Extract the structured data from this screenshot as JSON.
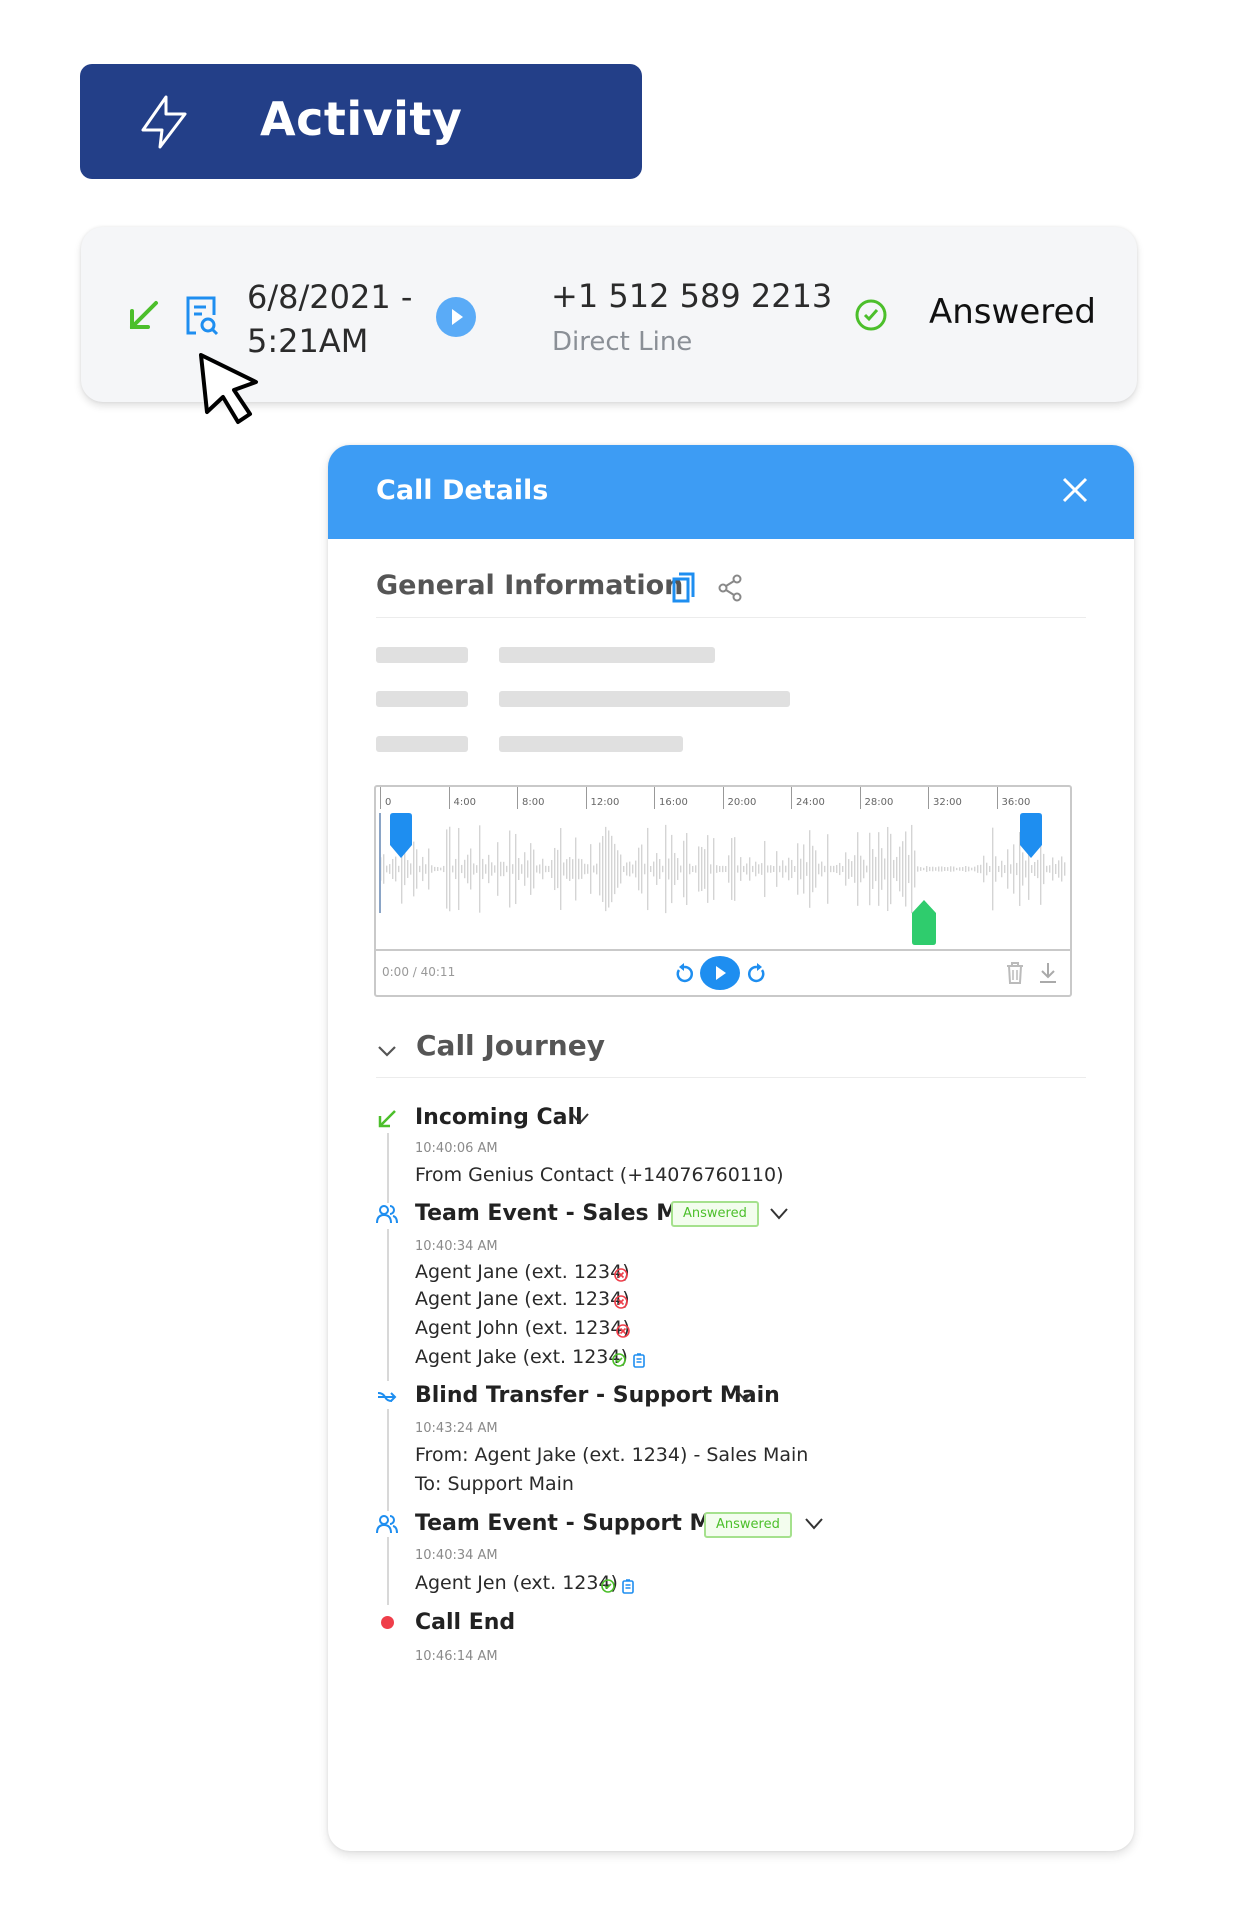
{
  "banner": {
    "title": "Activity",
    "icon": "lightning-bolt-icon"
  },
  "call_row": {
    "direction_icon": "incoming-arrow-icon",
    "details_icon": "document-search-icon",
    "date": "6/8/2021 -",
    "time": "5:21AM",
    "play_icon": "play-icon",
    "phone": "+1 512 589 2213",
    "line": "Direct Line",
    "status_icon": "check-circle-icon",
    "status": "Answered",
    "colors": {
      "incoming": "#4cbf2b",
      "accent": "#1e8ef0",
      "status": "#4cbf2b"
    }
  },
  "panel": {
    "title": "Call Details",
    "close_label": "X",
    "general_info": {
      "title": "General Information",
      "copy_icon": "copy-icon",
      "share_icon": "share-icon"
    },
    "player": {
      "ruler_labels": [
        "0",
        "4:00",
        "8:00",
        "12:00",
        "16:00",
        "20:00",
        "24:00",
        "28:00",
        "32:00",
        "36:00"
      ],
      "time": "0:00 / 40:11",
      "controls": [
        "rewind-icon",
        "play-icon",
        "forward-icon",
        "trash-icon",
        "download-icon"
      ]
    },
    "journey": {
      "title": "Call Journey",
      "events": [
        {
          "type": "incoming",
          "title": "Incoming Call",
          "time": "10:40:06 AM",
          "lines": [
            "From Genius Contact (+14076760110)"
          ]
        },
        {
          "type": "team",
          "title": "Team Event - Sales Main",
          "badge": "Answered",
          "time": "10:40:34 AM",
          "agents": [
            {
              "label": "Agent Jane (ext. 1234)",
              "status": "missed"
            },
            {
              "label": "Agent Jane (ext. 1234)",
              "status": "missed"
            },
            {
              "label": "Agent John (ext. 1234)",
              "status": "missed"
            },
            {
              "label": "Agent Jake (ext. 1234)",
              "status": "answered",
              "notes": true
            }
          ]
        },
        {
          "type": "transfer",
          "title": "Blind Transfer - Support Main",
          "time": "10:43:24 AM",
          "lines": [
            "From: Agent Jake (ext. 1234) - Sales Main",
            "To: Support Main"
          ]
        },
        {
          "type": "team",
          "title": "Team Event - Support Main",
          "badge": "Answered",
          "time": "10:40:34 AM",
          "agents": [
            {
              "label": "Agent Jen (ext. 1234)",
              "status": "answered",
              "notes": true
            }
          ]
        },
        {
          "type": "end",
          "title": "Call End",
          "time": "10:46:14 AM"
        }
      ]
    }
  }
}
